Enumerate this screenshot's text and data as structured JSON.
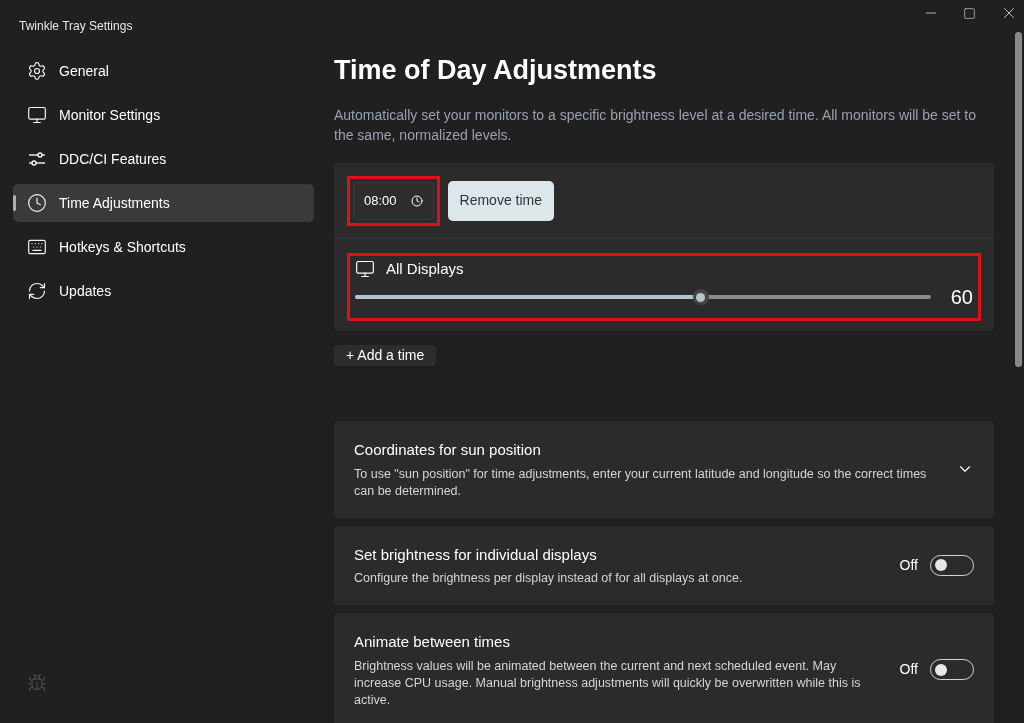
{
  "window": {
    "title": "Twinkle Tray Settings"
  },
  "sidebar": {
    "items": [
      {
        "kind": "gear",
        "label": "General",
        "selected": false
      },
      {
        "kind": "monitor",
        "label": "Monitor Settings",
        "selected": false
      },
      {
        "kind": "sliders",
        "label": "DDC/CI Features",
        "selected": false
      },
      {
        "kind": "clock",
        "label": "Time Adjustments",
        "selected": true
      },
      {
        "kind": "keyboard",
        "label": "Hotkeys & Shortcuts",
        "selected": false
      },
      {
        "kind": "refresh",
        "label": "Updates",
        "selected": false
      }
    ]
  },
  "page": {
    "title": "Time of Day Adjustments",
    "description": "Automatically set your monitors to a specific brightness level at a desired time. All monitors will be set to the same, normalized levels."
  },
  "times": [
    {
      "time": "08:00",
      "remove_label": "Remove time",
      "display": {
        "name": "All Displays",
        "level": 0.6,
        "reading": "60"
      }
    }
  ],
  "add_time_label": "+ Add a time",
  "settings": [
    {
      "kind": "expander",
      "title": "Coordinates for sun position",
      "description": "To use \"sun position\" for time adjustments, enter your current latitude and longitude so the correct times can be determined."
    },
    {
      "kind": "toggle",
      "title": "Set brightness for individual displays",
      "description": "Configure the brightness per display instead of for all displays at once.",
      "on": false,
      "state_label": "Off"
    },
    {
      "kind": "toggle",
      "title": "Animate between times",
      "description": "Brightness values will be animated between the current and next scheduled event. May increase CPU usage. Manual brightness adjustments will quickly be overwritten while this is active.",
      "on": false,
      "state_label": "Off"
    }
  ]
}
